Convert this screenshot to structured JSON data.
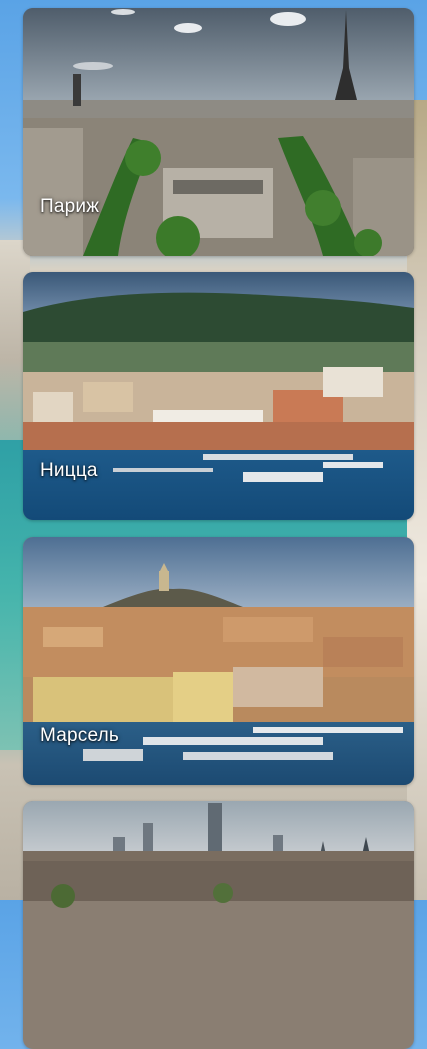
{
  "cities": [
    {
      "name": "Париж"
    },
    {
      "name": "Ницца"
    },
    {
      "name": "Марсель"
    },
    {
      "name": ""
    }
  ]
}
